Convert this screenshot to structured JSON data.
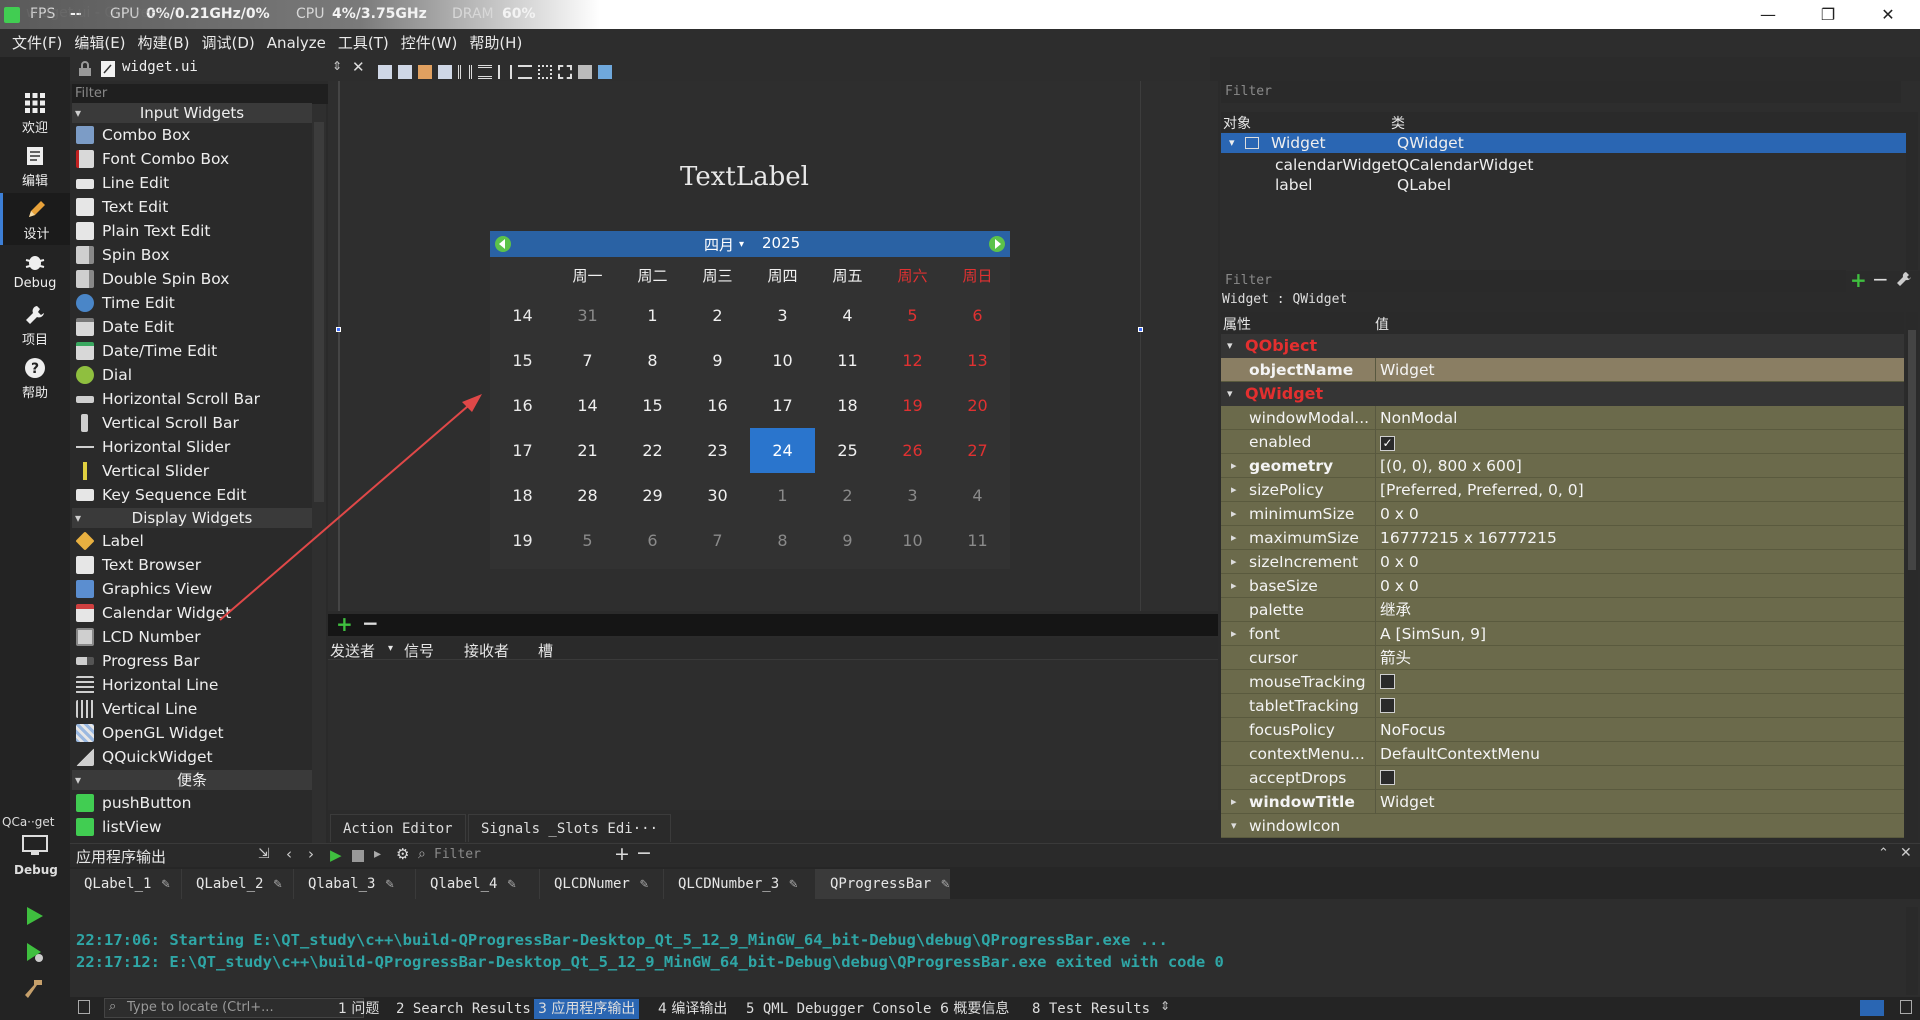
{
  "perf": {
    "fps_label": "FPS",
    "fps": "--",
    "gpu_label": "GPU",
    "gpu": "0%/0.21GHz/0%",
    "cpu_label": "CPU",
    "cpu": "4%/3.75GHz",
    "dram_label": "DRAM",
    "dram": "60%",
    "window_title": "widget.ui - Qt Creator"
  },
  "window_buttons": {
    "minimize": "—",
    "maximize": "❐",
    "close": "✕"
  },
  "menus": [
    "文件(F)",
    "编辑(E)",
    "构建(B)",
    "调试(D)",
    "Analyze",
    "工具(T)",
    "控件(W)",
    "帮助(H)"
  ],
  "modes": [
    {
      "label": "欢迎",
      "icon": "grid-icon"
    },
    {
      "label": "编辑",
      "icon": "edit-doc-icon"
    },
    {
      "label": "设计",
      "icon": "pencil-icon"
    },
    {
      "label": "Debug",
      "icon": "bug-icon"
    },
    {
      "label": "项目",
      "icon": "wrench-icon"
    },
    {
      "label": "帮助",
      "icon": "help-icon"
    }
  ],
  "kit": {
    "label": "QCa··get",
    "mode": "Debug"
  },
  "doc": {
    "file": "widget.ui"
  },
  "widgetbox": {
    "filter": "Filter",
    "cat_input": "Input Widgets",
    "input_items": [
      "Combo Box",
      "Font Combo Box",
      "Line Edit",
      "Text Edit",
      "Plain Text Edit",
      "Spin Box",
      "Double Spin Box",
      "Time Edit",
      "Date Edit",
      "Date/Time Edit",
      "Dial",
      "Horizontal Scroll Bar",
      "Vertical Scroll Bar",
      "Horizontal Slider",
      "Vertical Slider",
      "Key Sequence Edit"
    ],
    "cat_display": "Display Widgets",
    "display_items": [
      "Label",
      "Text Browser",
      "Graphics View",
      "Calendar Widget",
      "LCD Number",
      "Progress Bar",
      "Horizontal Line",
      "Vertical Line",
      "OpenGL Widget",
      "QQuickWidget"
    ],
    "cat_notes": "便条",
    "notes_items": [
      "pushButton",
      "listView"
    ]
  },
  "form": {
    "textlabel": "TextLabel",
    "calendar": {
      "month": "四月",
      "year": "2025",
      "headers": [
        "周一",
        "周二",
        "周三",
        "周四",
        "周五",
        "周六",
        "周日"
      ],
      "weeks": [
        {
          "num": "14",
          "days": [
            "31",
            "1",
            "2",
            "3",
            "4",
            "5",
            "6"
          ]
        },
        {
          "num": "15",
          "days": [
            "7",
            "8",
            "9",
            "10",
            "11",
            "12",
            "13"
          ]
        },
        {
          "num": "16",
          "days": [
            "14",
            "15",
            "16",
            "17",
            "18",
            "19",
            "20"
          ]
        },
        {
          "num": "17",
          "days": [
            "21",
            "22",
            "23",
            "24",
            "25",
            "26",
            "27"
          ]
        },
        {
          "num": "18",
          "days": [
            "28",
            "29",
            "30",
            "1",
            "2",
            "3",
            "4"
          ]
        },
        {
          "num": "19",
          "days": [
            "5",
            "6",
            "7",
            "8",
            "9",
            "10",
            "11"
          ]
        }
      ],
      "selected": "24"
    }
  },
  "signals": {
    "headers": [
      "发送者",
      "信号",
      "接收者",
      "槽"
    ],
    "tabs": [
      "Action Editor",
      "Signals _Slots Edi···"
    ]
  },
  "objinspector": {
    "filter": "Filter",
    "col_obj": "对象",
    "col_class": "类",
    "rows": [
      {
        "name": "Widget",
        "cls": "QWidget"
      },
      {
        "name": "calendarWidget",
        "cls": "QCalendarWidget"
      },
      {
        "name": "label",
        "cls": "QLabel"
      }
    ]
  },
  "propeditor": {
    "filter": "Filter",
    "context": "Widget : QWidget",
    "col_prop": "属性",
    "col_val": "值",
    "cat_qobject": "QObject",
    "cat_qwidget": "QWidget",
    "object_name": {
      "name": "objectName",
      "value": "Widget"
    },
    "props": [
      {
        "name": "windowModal...",
        "value": "NonModal"
      },
      {
        "name": "enabled",
        "value": "✓"
      },
      {
        "name": "geometry",
        "value": "[(0, 0), 800 x 600]"
      },
      {
        "name": "sizePolicy",
        "value": "[Preferred, Preferred, 0, 0]"
      },
      {
        "name": "minimumSize",
        "value": "0 x 0"
      },
      {
        "name": "maximumSize",
        "value": "16777215 x 16777215"
      },
      {
        "name": "sizeIncrement",
        "value": "0 x 0"
      },
      {
        "name": "baseSize",
        "value": "0 x 0"
      },
      {
        "name": "palette",
        "value": "继承"
      },
      {
        "name": "font",
        "value": "A [SimSun, 9]"
      },
      {
        "name": "cursor",
        "value": "箭头"
      },
      {
        "name": "mouseTracking",
        "value": ""
      },
      {
        "name": "tabletTracking",
        "value": ""
      },
      {
        "name": "focusPolicy",
        "value": "NoFocus"
      },
      {
        "name": "contextMenu...",
        "value": "DefaultContextMenu"
      },
      {
        "name": "acceptDrops",
        "value": ""
      },
      {
        "name": "windowTitle",
        "value": "Widget"
      },
      {
        "name": "windowIcon",
        "value": ""
      }
    ]
  },
  "output": {
    "title": "应用程序输出",
    "filter": "Filter",
    "tabs": [
      "QLabel_1",
      "QLabel_2",
      "Qlabal_3",
      "Qlabel_4",
      "QLCDNumer",
      "QLCDNumber_3",
      "QProgressBar"
    ],
    "lines": [
      "22:17:06: Starting E:\\QT_study\\c++\\build-QProgressBar-Desktop_Qt_5_12_9_MinGW_64_bit-Debug\\debug\\QProgressBar.exe ...",
      "22:17:12: E:\\QT_study\\c++\\build-QProgressBar-Desktop_Qt_5_12_9_MinGW_64_bit-Debug\\debug\\QProgressBar.exe exited with code 0"
    ]
  },
  "status": {
    "locate": "Type to locate (Ctrl+...",
    "tabs": [
      "1 问题",
      "2 Search Results",
      "3 应用程序输出",
      "4 编译输出",
      "5 QML Debugger Console",
      "6 概要信息",
      "8 Test Results"
    ]
  },
  "colors": {
    "accent": "#2a66b3",
    "weekend": "#e03131",
    "output_text": "#2fa6a6",
    "prop_row": "#6b6a4b"
  }
}
